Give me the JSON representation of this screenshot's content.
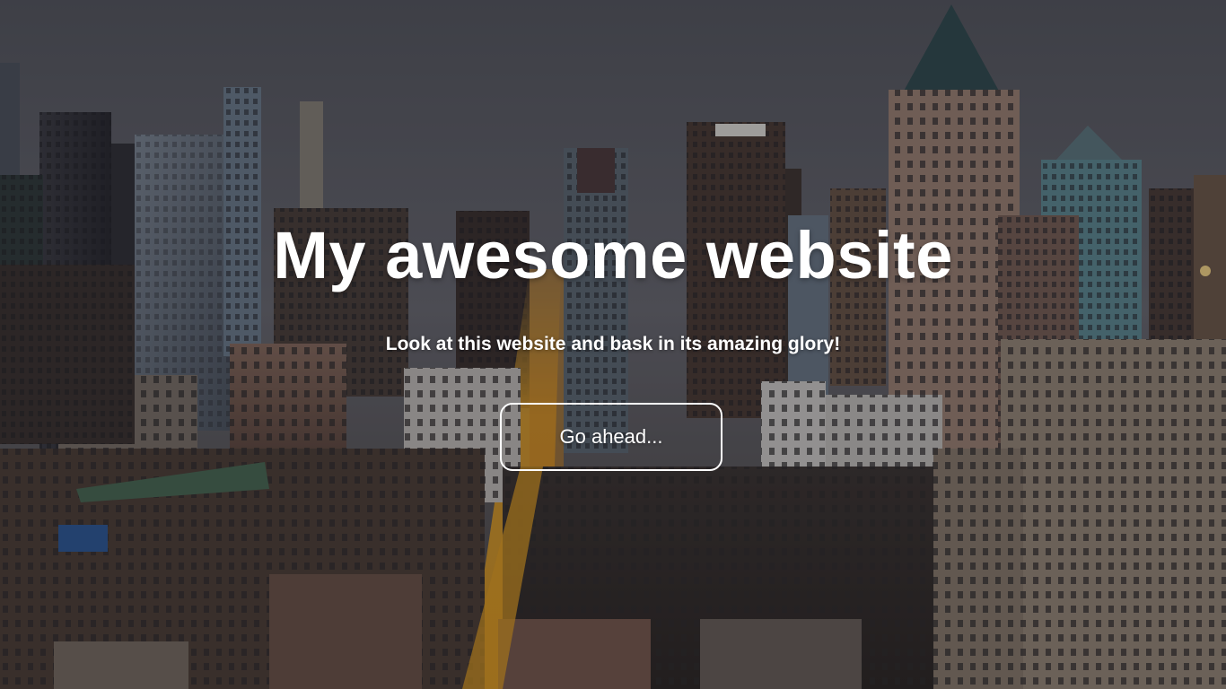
{
  "hero": {
    "title": "My awesome website",
    "subtitle": "Look at this website and bask in its amazing glory!",
    "cta_label": "Go ahead..."
  },
  "background": {
    "description_icon": "city-skyline-image",
    "sky_color": "#5d5f66",
    "sunlight_color": "#e8a21d"
  }
}
